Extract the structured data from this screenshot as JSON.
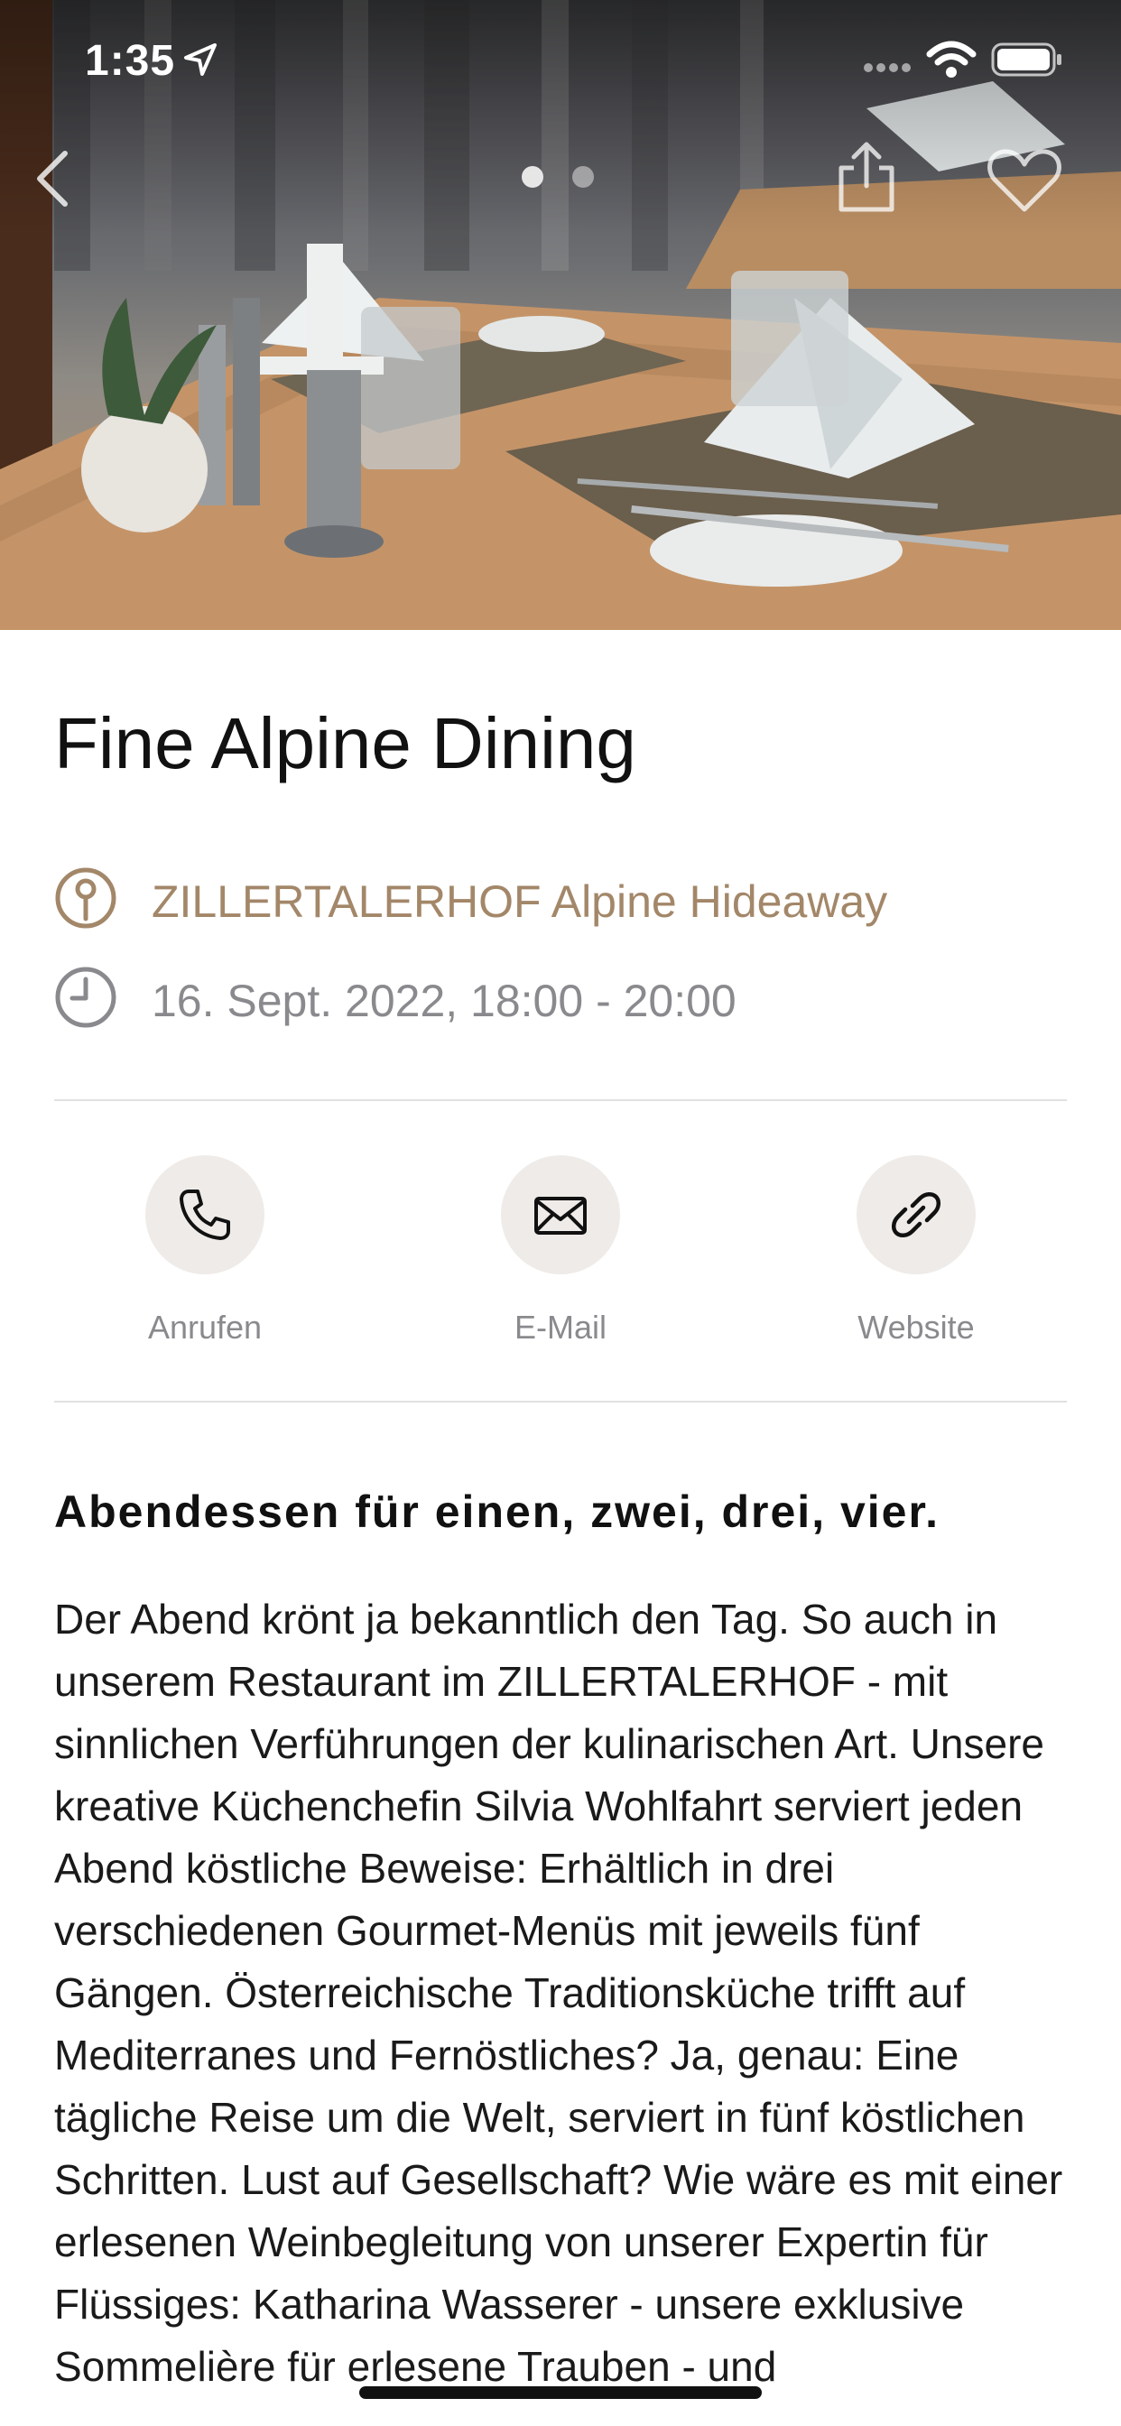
{
  "status_bar": {
    "time": "1:35",
    "icons": [
      "location-arrow-icon",
      "signal-icon",
      "wifi-icon",
      "battery-icon"
    ]
  },
  "hero": {
    "image_description_icon": "restaurant-table-photo",
    "pager": {
      "current": 1,
      "total": 2
    },
    "icons": [
      "back-chevron-icon",
      "share-icon",
      "heart-icon"
    ]
  },
  "event": {
    "title": "Fine Alpine Dining",
    "location": "ZILLERTALERHOF Alpine Hideaway",
    "datetime": "16. Sept. 2022, 18:00 - 20:00"
  },
  "actions": [
    {
      "label": "Anrufen",
      "icon": "phone-icon"
    },
    {
      "label": "E-Mail",
      "icon": "mail-icon"
    },
    {
      "label": "Website",
      "icon": "link-icon"
    }
  ],
  "description": {
    "heading": "Abendessen für einen, zwei, drei, vier.",
    "text": "Der Abend krönt ja bekanntlich den Tag. So auch in unserem Restaurant im ZILLERTALERHOF - mit sinnlichen Verführungen der kulinarischen Art. Unsere kreative Küchenchefin Silvia Wohlfahrt serviert jeden Abend köstliche Beweise: Erhältlich in drei verschiedenen Gourmet-Menüs mit jeweils fünf Gängen. Österreichische Traditionsküche trifft auf Mediterranes und Fernöstliches? Ja, genau: Eine tägliche Reise um die Welt, serviert in fünf köstlichen Schritten. Lust auf Gesellschaft? Wie wäre es mit einer erlesenen Weinbegleitung von unserer Expertin für Flüssiges: Katharina Wasserer - unsere exklusive Sommelière für erlesene Trauben - und"
  },
  "colors": {
    "accent": "#a38769",
    "secondary_text": "#8a8a8e",
    "action_circle": "#efebe8",
    "divider": "#e1e1e1"
  }
}
